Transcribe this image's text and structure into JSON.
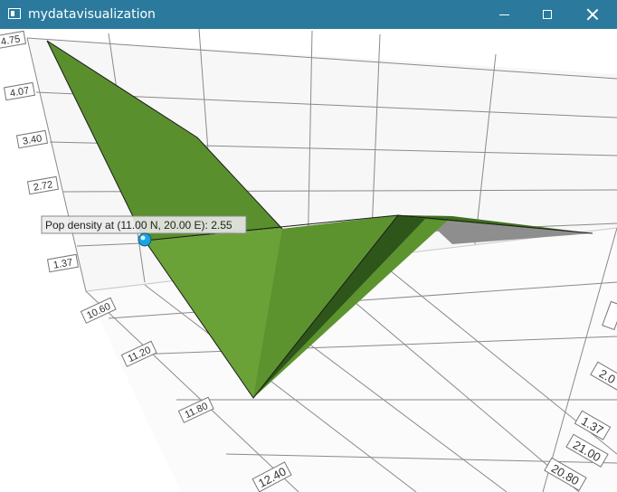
{
  "window": {
    "title": "mydatavisualization",
    "icons": {
      "app": "window-app-icon",
      "minimize": "minimize-icon",
      "maximize": "maximize-icon",
      "close": "close-icon"
    }
  },
  "colors": {
    "titlebar": "#2b7a9e",
    "surface": "#5f9630",
    "surface_dark": "#3e6a1c",
    "selection": "#1aa3e0"
  },
  "chart_data": {
    "type": "surface",
    "y_ticks": [
      "4.75",
      "4.07",
      "3.40",
      "2.72",
      "1.37"
    ],
    "x_ticks": [
      "10.60",
      "11.20",
      "11.80",
      "12.40"
    ],
    "z_ticks": [
      "21.00",
      "20.80"
    ],
    "right_ticks": [
      "2.0",
      "1.37"
    ],
    "selected_point": {
      "latitude": 11.0,
      "longitude": 20.0,
      "value": 2.55
    },
    "tooltip": "Pop density at (11.00 N, 20.00 E): 2.55",
    "grid": true
  }
}
